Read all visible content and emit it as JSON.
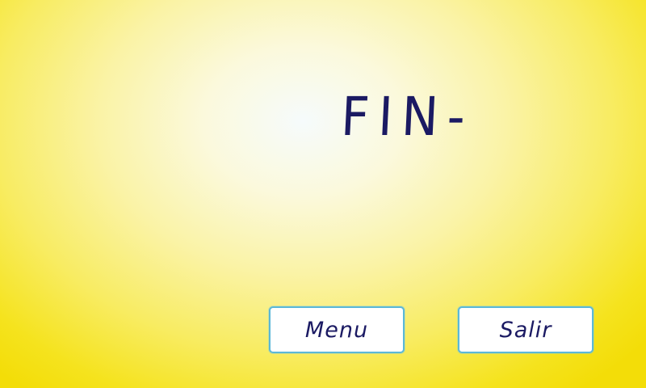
{
  "screen": {
    "title": "FIN-"
  },
  "buttons": {
    "menu_label": "Menu",
    "exit_label": "Salir"
  },
  "colors": {
    "background_edge": "#f3dd08",
    "background_center": "#f6fbfc",
    "text": "#1b1a63",
    "button_border": "#5bb8d8",
    "button_fill": "#ffffff"
  }
}
